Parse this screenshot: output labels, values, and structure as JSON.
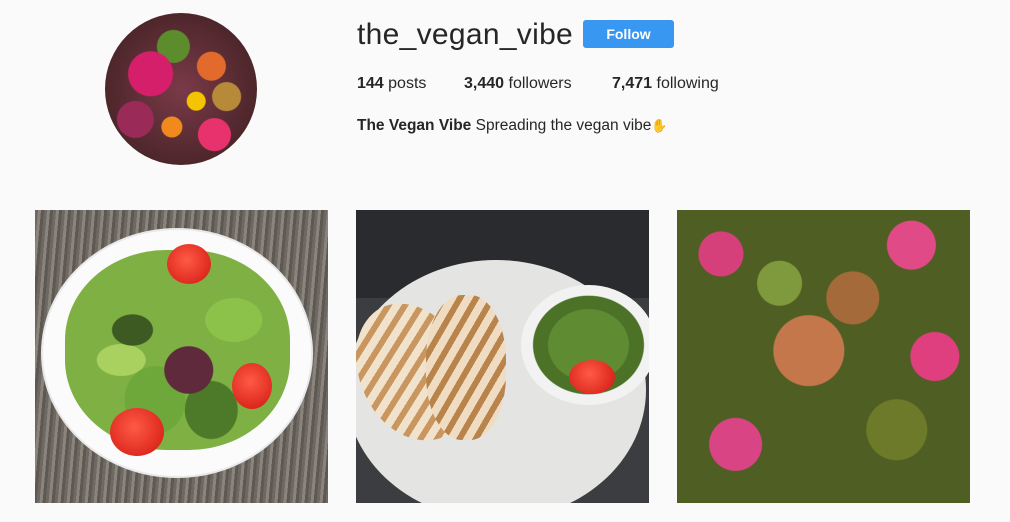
{
  "profile": {
    "username": "the_vegan_vibe",
    "follow_label": "Follow",
    "stats": {
      "posts_count": "144",
      "posts_label": "posts",
      "followers_count": "3,440",
      "followers_label": "followers",
      "following_count": "7,471",
      "following_label": "following"
    },
    "bio_name": "The Vegan Vibe",
    "bio_text": "Spreading the vegan vibe",
    "bio_emoji": "✋"
  },
  "colors": {
    "accent": "#3897f0",
    "text": "#262626",
    "background": "#fafafa"
  }
}
